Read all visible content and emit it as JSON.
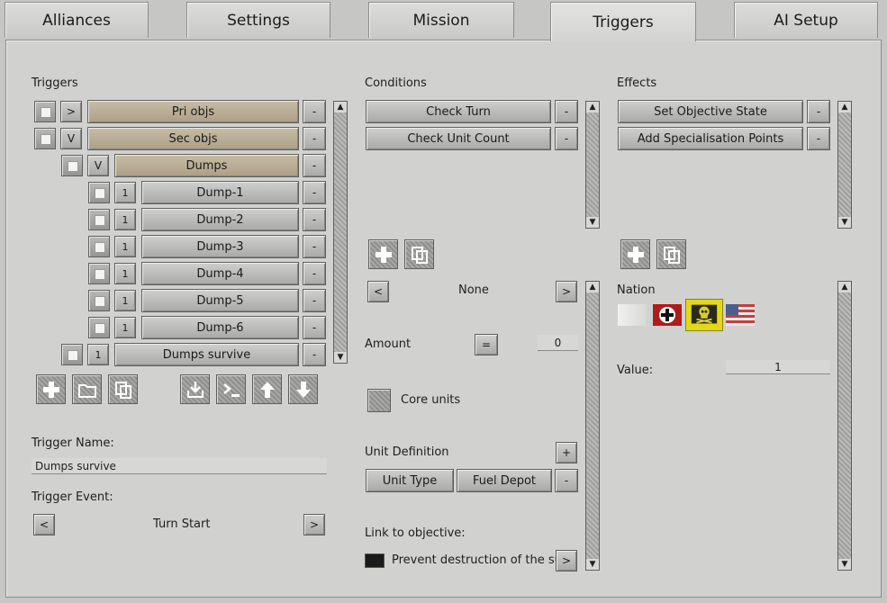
{
  "tabs": [
    "Alliances",
    "Settings",
    "Mission",
    "Triggers",
    "AI Setup"
  ],
  "active_tab": "Triggers",
  "triggers": {
    "heading": "Triggers",
    "rows": [
      {
        "toggle": ">",
        "label": "Pri objs",
        "del": "-"
      },
      {
        "toggle": "V",
        "label": "Sec objs",
        "del": "-"
      },
      {
        "toggle": "V",
        "label": "Dumps",
        "del": "-"
      },
      {
        "toggle": "1",
        "label": "Dump-1",
        "del": "-"
      },
      {
        "toggle": "1",
        "label": "Dump-2",
        "del": "-"
      },
      {
        "toggle": "1",
        "label": "Dump-3",
        "del": "-"
      },
      {
        "toggle": "1",
        "label": "Dump-4",
        "del": "-"
      },
      {
        "toggle": "1",
        "label": "Dump-5",
        "del": "-"
      },
      {
        "toggle": "1",
        "label": "Dump-6",
        "del": "-"
      },
      {
        "toggle": "1",
        "label": "Dumps survive",
        "del": "-"
      }
    ],
    "name_label": "Trigger Name:",
    "name_value": "Dumps survive",
    "event_label": "Trigger Event:",
    "event_value": "Turn Start",
    "prev": "<",
    "next": ">"
  },
  "conditions": {
    "heading": "Conditions",
    "items": [
      "Check Turn",
      "Check Unit Count"
    ],
    "del": "-",
    "selector_value": "None",
    "prev": "<",
    "next": ">",
    "amount_label": "Amount",
    "amount_op": "=",
    "amount_value": "0",
    "core_units_label": "Core units",
    "unit_def_label": "Unit Definition",
    "plus": "+",
    "unit_type_label": "Unit Type",
    "unit_type_value": "Fuel Depot",
    "link_label": "Link to objective:",
    "link_value": "Prevent destruction of the supply d"
  },
  "effects": {
    "heading": "Effects",
    "items": [
      "Set Objective State",
      "Add Specialisation Points"
    ],
    "del": "-",
    "nation_label": "Nation",
    "value_label": "Value:",
    "value": "1"
  },
  "colors": {
    "highlight": "#e3d71a",
    "tan": "#bcae95"
  }
}
